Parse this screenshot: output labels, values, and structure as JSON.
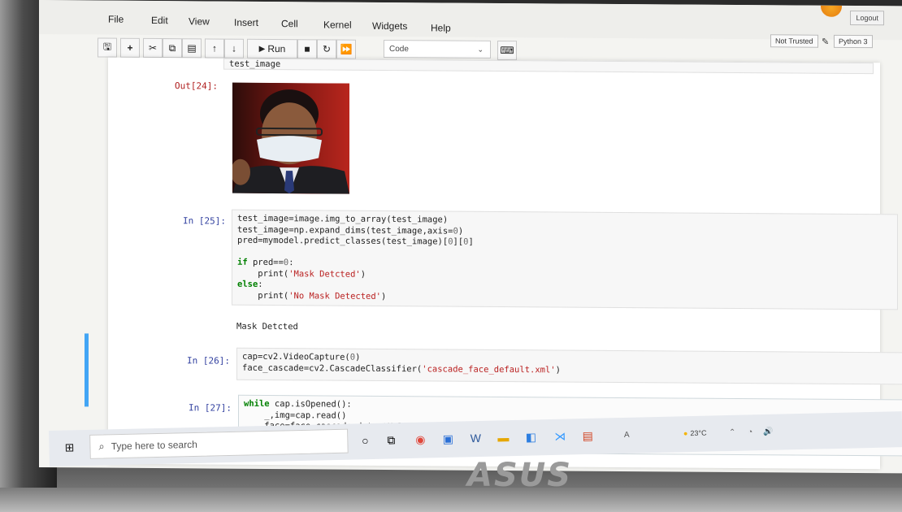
{
  "menubar": {
    "items": [
      "File",
      "Edit",
      "View",
      "Insert",
      "Cell",
      "Kernel",
      "Widgets",
      "Help"
    ],
    "not_trusted": "Not Trusted",
    "kernel_name": "Python 3",
    "logout": "Logout"
  },
  "toolbar": {
    "run_label": "Run",
    "cell_type": "Code"
  },
  "cells": {
    "c24": {
      "truncated_code": "test_image",
      "out_prompt": "Out[24]:"
    },
    "c25": {
      "prompt": "In [25]:",
      "output": "Mask Detcted"
    },
    "c26": {
      "prompt": "In [26]:"
    },
    "c27": {
      "prompt": "In [27]:"
    }
  },
  "taskbar": {
    "search_placeholder": "Type here to search",
    "weather": "23°C"
  },
  "brand": "ASUS"
}
